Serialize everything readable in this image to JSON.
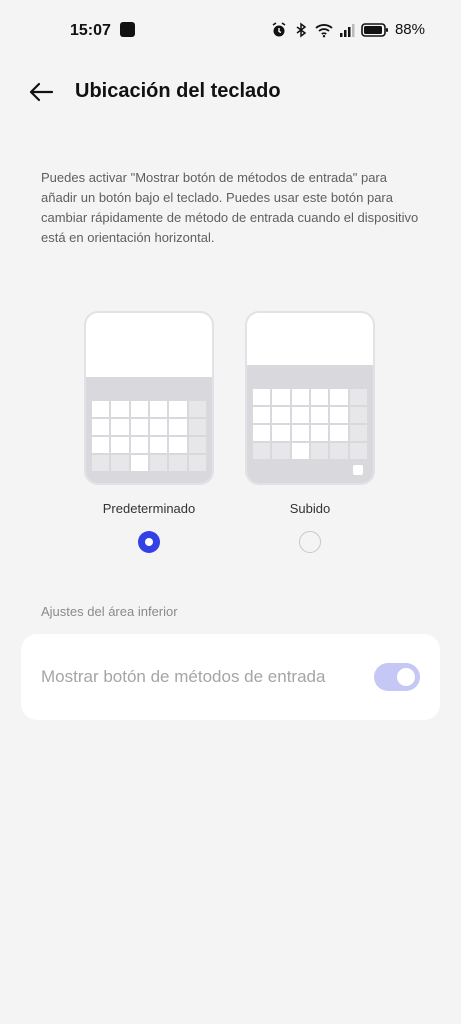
{
  "status_bar": {
    "time": "15:07",
    "battery_percent": "88%",
    "icons": [
      "app-notification-icon",
      "alarm-icon",
      "bluetooth-icon",
      "wifi-icon",
      "signal-icon",
      "battery-icon"
    ]
  },
  "header": {
    "back_icon": "arrow-left-icon",
    "title": "Ubicación del teclado"
  },
  "description": "Puedes activar \"Mostrar botón de métodos de entrada\" para añadir un botón bajo el teclado. Puedes usar este botón para cambiar rápidamente de método de entrada cuando el dispositivo está en orientación horizontal.",
  "options": [
    {
      "label": "Predeterminado",
      "selected": true
    },
    {
      "label": "Subido",
      "selected": false
    }
  ],
  "bottom_section": {
    "title": "Ajustes del área inferior",
    "setting_label": "Mostrar botón de métodos de entrada",
    "toggle_on": true,
    "toggle_enabled": false
  },
  "colors": {
    "accent": "#3340e6",
    "background": "#f4f4f4",
    "toggle_disabled_on": "#c5c8f4"
  }
}
